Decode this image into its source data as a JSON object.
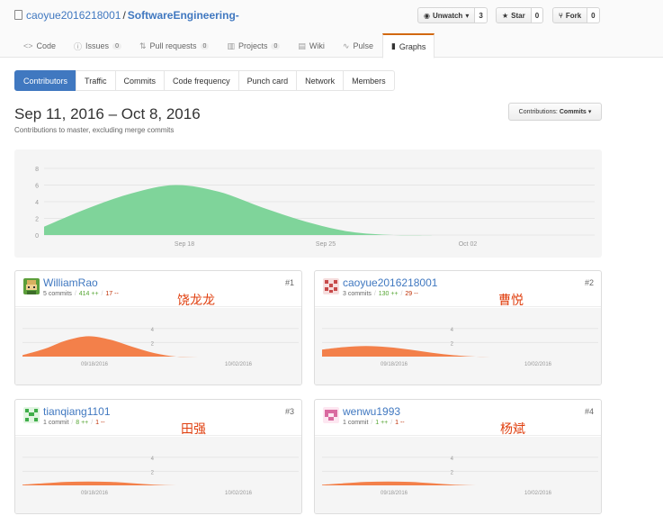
{
  "repo": {
    "owner": "caoyue2016218001",
    "separator": "/",
    "name": "SoftwareEngineering-"
  },
  "actions": {
    "watch_label": "Unwatch",
    "watch_count": "3",
    "star_label": "Star",
    "star_count": "0",
    "fork_label": "Fork",
    "fork_count": "0"
  },
  "reponav": {
    "code": "Code",
    "issues": "Issues",
    "issues_count": "0",
    "pulls": "Pull requests",
    "pulls_count": "0",
    "projects": "Projects",
    "projects_count": "0",
    "wiki": "Wiki",
    "pulse": "Pulse",
    "graphs": "Graphs"
  },
  "subnav": {
    "contributors": "Contributors",
    "traffic": "Traffic",
    "commits": "Commits",
    "code_frequency": "Code frequency",
    "punch_card": "Punch card",
    "network": "Network",
    "members": "Members"
  },
  "summary": {
    "date_range": "Sep 11, 2016 – Oct 8, 2016",
    "subtitle": "Contributions to master, excluding merge commits",
    "select_prefix": "Contributions:",
    "select_value": "Commits"
  },
  "colors": {
    "main_area": "#7fd49a",
    "person_area": "#f3804a",
    "link": "#4078c0",
    "annotation": "#e04010"
  },
  "chart_data": [
    {
      "type": "area",
      "x_ticks": [
        "Sep 18",
        "Sep 25",
        "Oct 02"
      ],
      "y_ticks": [
        "0",
        "2",
        "4",
        "6",
        "8"
      ],
      "ylim": [
        0,
        8
      ],
      "series": [
        {
          "values": [
            1,
            3.2,
            5,
            6,
            5.2,
            3.3,
            1.6,
            0.4,
            0,
            0
          ]
        }
      ]
    }
  ],
  "contributors": [
    {
      "username": "WilliamRao",
      "commits": "5 commits",
      "additions": "414 ++",
      "deletions": "17 --",
      "rank": "#1",
      "annotation": "饶龙龙",
      "x_ticks": [
        "09/18/2016",
        "10/02/2016"
      ],
      "y_ticks": [
        "2",
        "4"
      ],
      "ylim": [
        0,
        5
      ],
      "values": [
        0.2,
        1.1,
        2.3,
        2.9,
        2.4,
        1.4,
        0.5,
        0,
        0,
        0
      ]
    },
    {
      "username": "caoyue2016218001",
      "commits": "3 commits",
      "additions": "130 ++",
      "deletions": "29 --",
      "rank": "#2",
      "annotation": "曹悦",
      "x_ticks": [
        "09/18/2016",
        "10/02/2016"
      ],
      "y_ticks": [
        "2",
        "4"
      ],
      "ylim": [
        0,
        5
      ],
      "values": [
        1,
        1.35,
        1.5,
        1.35,
        1,
        0.55,
        0.2,
        0,
        0,
        0
      ]
    },
    {
      "username": "tianqiang1101",
      "commits": "1 commit",
      "additions": "8 ++",
      "deletions": "1 --",
      "rank": "#3",
      "annotation": "田强",
      "x_ticks": [
        "09/18/2016",
        "10/02/2016"
      ],
      "y_ticks": [
        "2",
        "4"
      ],
      "ylim": [
        0,
        5
      ],
      "values": [
        0.1,
        0.3,
        0.5,
        0.55,
        0.5,
        0.3,
        0.1,
        0,
        0,
        0
      ]
    },
    {
      "username": "wenwu1993",
      "commits": "1 commit",
      "additions": "1 ++",
      "deletions": "1 --",
      "rank": "#4",
      "annotation": "杨斌",
      "x_ticks": [
        "09/18/2016",
        "10/02/2016"
      ],
      "y_ticks": [
        "2",
        "4"
      ],
      "ylim": [
        0,
        5
      ],
      "values": [
        0.1,
        0.3,
        0.5,
        0.55,
        0.5,
        0.3,
        0.1,
        0,
        0,
        0
      ]
    }
  ]
}
